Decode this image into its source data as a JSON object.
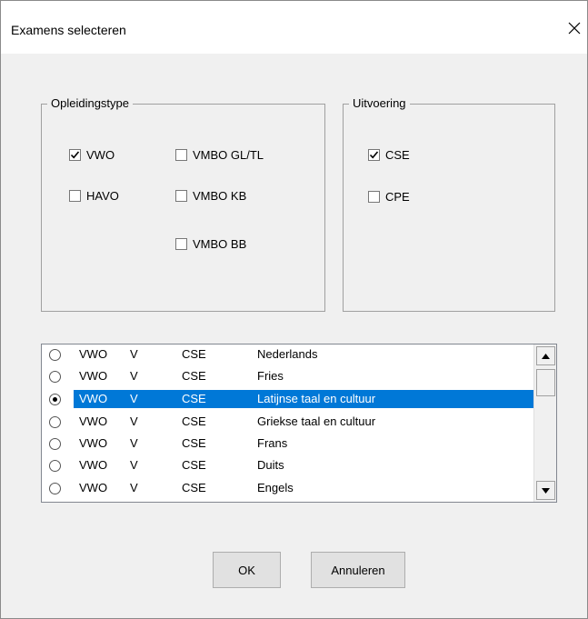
{
  "window": {
    "title": "Examens selecteren"
  },
  "group_opleiding": {
    "title": "Opleidingstype",
    "options": [
      {
        "label": "VWO",
        "checked": true
      },
      {
        "label": "HAVO",
        "checked": false
      },
      {
        "label": "VMBO GL/TL",
        "checked": false
      },
      {
        "label": "VMBO KB",
        "checked": false
      },
      {
        "label": "VMBO BB",
        "checked": false
      }
    ]
  },
  "group_uitvoering": {
    "title": "Uitvoering",
    "options": [
      {
        "label": "CSE",
        "checked": true
      },
      {
        "label": "CPE",
        "checked": false
      }
    ]
  },
  "exam_list": {
    "rows": [
      {
        "type": "VWO",
        "level": "V",
        "exam": "CSE",
        "subject": "Nederlands",
        "selected": false
      },
      {
        "type": "VWO",
        "level": "V",
        "exam": "CSE",
        "subject": "Fries",
        "selected": false
      },
      {
        "type": "VWO",
        "level": "V",
        "exam": "CSE",
        "subject": "Latijnse taal en cultuur",
        "selected": true
      },
      {
        "type": "VWO",
        "level": "V",
        "exam": "CSE",
        "subject": "Griekse taal en cultuur",
        "selected": false
      },
      {
        "type": "VWO",
        "level": "V",
        "exam": "CSE",
        "subject": "Frans",
        "selected": false
      },
      {
        "type": "VWO",
        "level": "V",
        "exam": "CSE",
        "subject": "Duits",
        "selected": false
      },
      {
        "type": "VWO",
        "level": "V",
        "exam": "CSE",
        "subject": "Engels",
        "selected": false
      }
    ]
  },
  "buttons": {
    "ok": "OK",
    "cancel": "Annuleren"
  },
  "colors": {
    "selection": "#0078d7",
    "dialog_bg": "#f0f0f0",
    "title_bg": "#ffffff"
  },
  "icons": {
    "close": "close-icon",
    "check": "check-icon",
    "scroll_up": "arrow-up-icon",
    "scroll_down": "arrow-down-icon"
  }
}
